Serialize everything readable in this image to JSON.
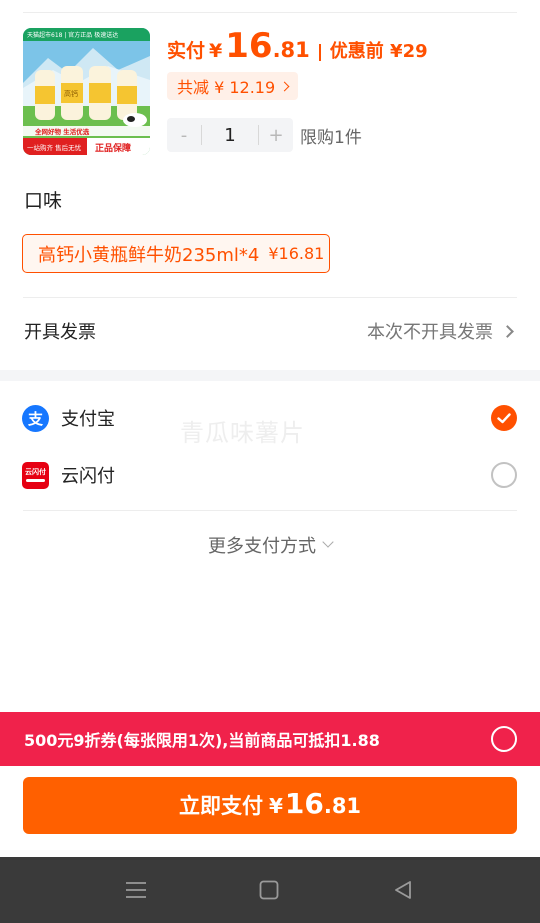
{
  "product": {
    "thumbnail_icon": "milk-bottles-product-image",
    "thumb_banner": "天猫超市618 | 官方正品 极速送达",
    "thumb_slogan": "全网好物 生活优选",
    "thumb_footer_left": "一站购齐 售后无忧",
    "thumb_footer_right": "正品保障",
    "thumb_bottle_label": "高钙",
    "price_label": "实付",
    "currency": "¥",
    "price_integer": "16",
    "price_decimal": ".81",
    "original_label": "优惠前 ¥29",
    "discount_label": "共减 ¥ 12.19",
    "quantity": "1",
    "minus_symbol": "-",
    "plus_symbol": "+",
    "limit_text": "限购1件"
  },
  "flavor": {
    "title": "口味",
    "option_name": "高钙小黄瓶鲜牛奶235ml*4",
    "option_price": "¥16.81"
  },
  "invoice": {
    "label": "开具发票",
    "value": "本次不开具发票"
  },
  "payment": {
    "methods": [
      {
        "name": "支付宝",
        "icon": "alipay-icon",
        "selected": true
      },
      {
        "name": "云闪付",
        "icon": "unionpay-quickpass-icon",
        "selected": false
      }
    ],
    "unionpay_icon_text": "云闪付",
    "alipay_icon_text": "支",
    "more_label": "更多支付方式"
  },
  "watermark": "青瓜味薯片",
  "coupon": {
    "text": "500元9折券(每张限用1次),当前商品可抵扣1.88",
    "selected": false
  },
  "pay_button": {
    "label": "立即支付",
    "currency": "¥",
    "amount_integer": "16",
    "amount_decimal": ".81"
  },
  "nav": {
    "items": [
      "menu-icon",
      "home-square-icon",
      "back-triangle-icon"
    ]
  },
  "colors": {
    "accent": "#ff5000",
    "pay_button": "#ff6000",
    "coupon_bar": "#f0224b",
    "alipay_blue": "#1677ff",
    "unionpay_red": "#e60012"
  }
}
